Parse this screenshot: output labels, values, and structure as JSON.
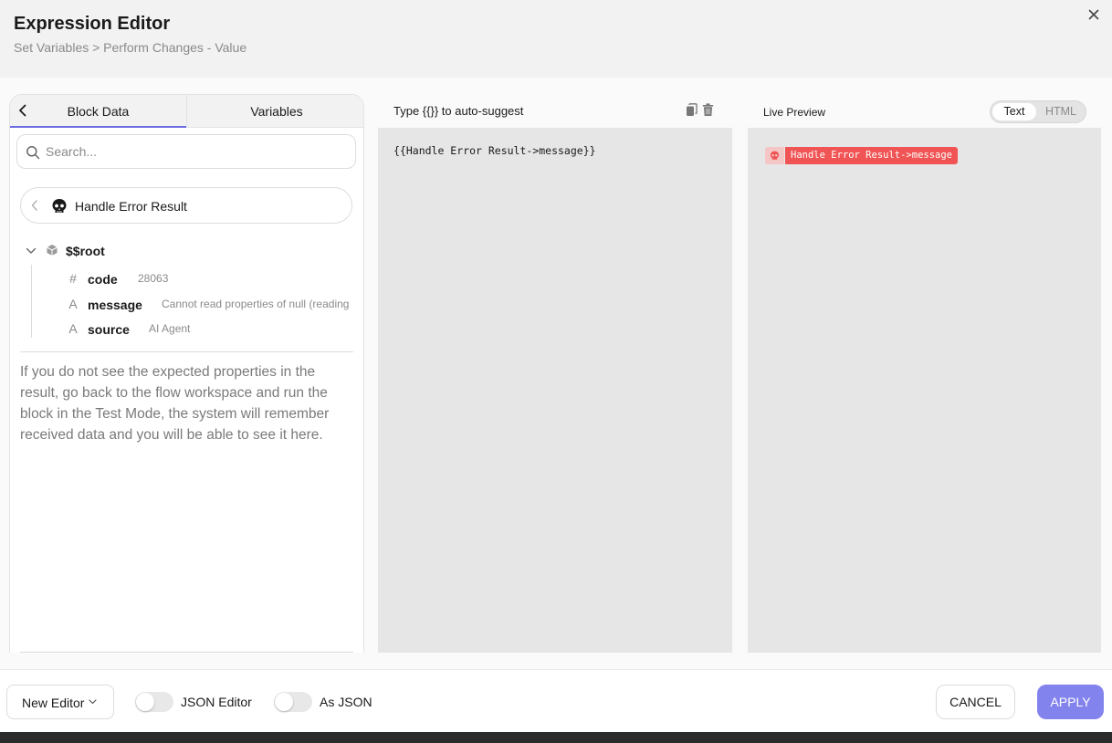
{
  "header": {
    "title": "Expression Editor",
    "breadcrumb": "Set Variables > Perform Changes - Value"
  },
  "left_panel": {
    "tabs": [
      {
        "label": "Block Data",
        "active": true
      },
      {
        "label": "Variables",
        "active": false
      }
    ],
    "search": {
      "placeholder": "Search...",
      "value": ""
    },
    "block": {
      "label": "Handle Error Result",
      "icon": "skull-icon"
    },
    "tree": {
      "root_label": "$$root",
      "properties": [
        {
          "type_icon": "#",
          "name": "code",
          "value": "28063"
        },
        {
          "type_icon": "A",
          "name": "message",
          "value": "Cannot read properties of null (reading"
        },
        {
          "type_icon": "A",
          "name": "source",
          "value": "AI Agent"
        }
      ]
    },
    "hint": "If you do not see the expected properties in the result, go back to the flow workspace and run the block in the Test Mode, the system will remember received data and you will be able to see it here."
  },
  "editor": {
    "heading": "Type {{}} to auto-suggest",
    "content": "{{Handle Error Result->message}}"
  },
  "preview": {
    "heading": "Live Preview",
    "modes": [
      {
        "label": "Text",
        "active": true
      },
      {
        "label": "HTML",
        "active": false
      }
    ],
    "token_label": "Handle Error Result->message"
  },
  "footer": {
    "editor_select": "New Editor",
    "toggles": [
      {
        "label": "JSON Editor",
        "on": false
      },
      {
        "label": "As JSON",
        "on": false
      }
    ],
    "cancel_label": "CANCEL",
    "apply_label": "APPLY"
  },
  "colors": {
    "accent": "#8383ee",
    "tab_underline": "#6b6be0",
    "token_bg": "#f05454"
  }
}
